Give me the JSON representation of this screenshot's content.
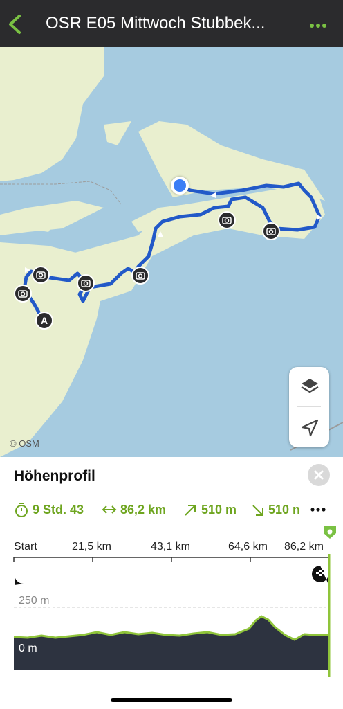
{
  "header": {
    "title": "OSR E05 Mittwoch Stubbek...",
    "back_icon": "chevron-left-icon",
    "menu_icon": "more-horizontal-icon",
    "accent": "#7ac143"
  },
  "map": {
    "attribution": "© OSM",
    "water_color": "#a6cbe0",
    "land_color": "#e9efcf",
    "route_color": "#2259c8",
    "start_marker": "A",
    "controls": [
      "layers-icon",
      "locate-arrow-icon"
    ]
  },
  "profile": {
    "heading": "Höhenprofil",
    "duration": "9 Std. 43",
    "distance": "86,2 km",
    "ascent": "510 m",
    "descent": "510 n",
    "axis_ticks": [
      "Start",
      "21,5 km",
      "43,1 km",
      "64,6 km",
      "86,2 km"
    ],
    "y_labels": [
      "250 m",
      "0 m"
    ],
    "icons": {
      "duration": "stopwatch-icon",
      "distance": "horizontal-arrows-icon",
      "ascent": "arrow-up-right-icon",
      "descent": "arrow-down-right-icon",
      "start": "play-icon",
      "finish": "finish-flag-icon",
      "close": "close-icon",
      "more": "more-horizontal-icon"
    }
  }
}
